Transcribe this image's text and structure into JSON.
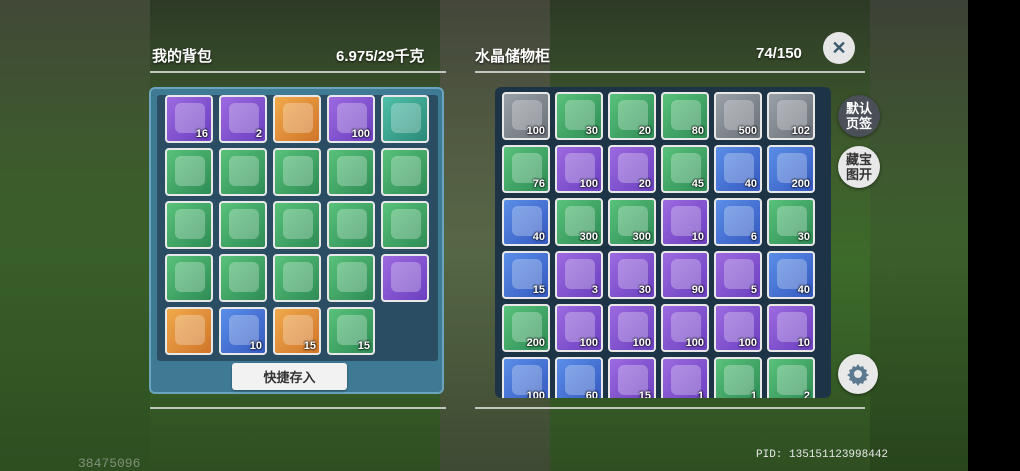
{
  "backpack": {
    "title": "我的背包",
    "weight": "6.975/29千克",
    "quick_store_label": "快捷存入",
    "slots": [
      {
        "icon": "scroll-icon",
        "color": "purple",
        "count": "16"
      },
      {
        "icon": "crystal-creature-icon",
        "color": "purple",
        "count": "2"
      },
      {
        "icon": "horn-icon",
        "color": "orange",
        "count": ""
      },
      {
        "icon": "goggles-creature-icon",
        "color": "purple",
        "count": "100"
      },
      {
        "icon": "cube-icon",
        "color": "teal",
        "count": ""
      },
      {
        "icon": "lantern-icon",
        "color": "green",
        "count": ""
      },
      {
        "icon": "lantern-icon",
        "color": "green",
        "count": ""
      },
      {
        "icon": "lantern-icon",
        "color": "green",
        "count": ""
      },
      {
        "icon": "lantern-icon",
        "color": "green",
        "count": ""
      },
      {
        "icon": "lantern-icon",
        "color": "green",
        "count": ""
      },
      {
        "icon": "lantern-icon",
        "color": "green",
        "count": ""
      },
      {
        "icon": "lantern-icon",
        "color": "green",
        "count": ""
      },
      {
        "icon": "lantern-icon",
        "color": "green",
        "count": ""
      },
      {
        "icon": "lantern-icon",
        "color": "green",
        "count": ""
      },
      {
        "icon": "lantern-icon",
        "color": "green",
        "count": ""
      },
      {
        "icon": "lantern-icon",
        "color": "green",
        "count": ""
      },
      {
        "icon": "blue-lizard-icon",
        "color": "green",
        "count": ""
      },
      {
        "icon": "blue-lizard-icon",
        "color": "green",
        "count": ""
      },
      {
        "icon": "fish-fillet-icon",
        "color": "green",
        "count": ""
      },
      {
        "icon": "bow-icon",
        "color": "purple",
        "count": ""
      },
      {
        "icon": "crystal-cat-icon",
        "color": "orange",
        "count": ""
      },
      {
        "icon": "salmon-dish-icon",
        "color": "blue",
        "count": "10"
      },
      {
        "icon": "pet-food-bag-icon",
        "color": "orange",
        "count": "15"
      },
      {
        "icon": "soup-bowl-icon",
        "color": "green",
        "count": "15"
      }
    ]
  },
  "storage": {
    "title": "水晶储物柜",
    "capacity": "74/150",
    "slots": [
      {
        "icon": "flower-pot-icon",
        "color": "gray",
        "count": "100"
      },
      {
        "icon": "blue-berries-icon",
        "color": "green",
        "count": "30"
      },
      {
        "icon": "bones-icon",
        "color": "green",
        "count": "20"
      },
      {
        "icon": "leaves-icon",
        "color": "green",
        "count": "80"
      },
      {
        "icon": "raw-meat-icon",
        "color": "gray",
        "count": "500"
      },
      {
        "icon": "raw-meat-icon",
        "color": "gray",
        "count": "102"
      },
      {
        "icon": "bacon-icon",
        "color": "green",
        "count": "76"
      },
      {
        "icon": "bacon-icon",
        "color": "purple",
        "count": "100"
      },
      {
        "icon": "bacon-icon",
        "color": "purple",
        "count": "20"
      },
      {
        "icon": "bird-icon",
        "color": "green",
        "count": "45"
      },
      {
        "icon": "purple-berries-bowl-icon",
        "color": "blue",
        "count": "40"
      },
      {
        "icon": "insect-icon",
        "color": "blue",
        "count": "200"
      },
      {
        "icon": "insect-icon",
        "color": "blue",
        "count": "40"
      },
      {
        "icon": "shrimp-icon",
        "color": "green",
        "count": "300"
      },
      {
        "icon": "shrimp-icon",
        "color": "green",
        "count": "300"
      },
      {
        "icon": "orange-fish-icon",
        "color": "purple",
        "count": "10"
      },
      {
        "icon": "green-fish-icon",
        "color": "blue",
        "count": "6"
      },
      {
        "icon": "firefly-icon",
        "color": "green",
        "count": "30"
      },
      {
        "icon": "pink-flower-icon",
        "color": "blue",
        "count": "15"
      },
      {
        "icon": "feather-icon",
        "color": "purple",
        "count": "3"
      },
      {
        "icon": "food-bag-icon",
        "color": "purple",
        "count": "30"
      },
      {
        "icon": "food-bag-icon",
        "color": "purple",
        "count": "90"
      },
      {
        "icon": "food-bag-icon",
        "color": "purple",
        "count": "5"
      },
      {
        "icon": "fish-dish-icon",
        "color": "blue",
        "count": "40"
      },
      {
        "icon": "fish-dish-icon",
        "color": "green",
        "count": "200"
      },
      {
        "icon": "golden-egg-icon",
        "color": "purple",
        "count": "100"
      },
      {
        "icon": "golden-egg-icon",
        "color": "purple",
        "count": "100"
      },
      {
        "icon": "golden-egg-icon",
        "color": "purple",
        "count": "100"
      },
      {
        "icon": "golden-egg-icon",
        "color": "purple",
        "count": "100"
      },
      {
        "icon": "milk-carton-icon",
        "color": "purple",
        "count": "10"
      },
      {
        "icon": "white-flower-icon",
        "color": "blue",
        "count": "100"
      },
      {
        "icon": "pink-flower-icon",
        "color": "blue",
        "count": "60"
      },
      {
        "icon": "sack-icon",
        "color": "purple",
        "count": "15"
      },
      {
        "icon": "sack-icon",
        "color": "purple",
        "count": "1"
      },
      {
        "icon": "seed-bag-icon",
        "color": "green",
        "count": "1"
      },
      {
        "icon": "seed-bag-icon",
        "color": "green",
        "count": "2"
      }
    ]
  },
  "buttons": {
    "close_label": "✕",
    "default_page_label": "默认页签",
    "treasure_map_label": "藏宝图开",
    "settings_icon": "gear-icon"
  },
  "footer": {
    "pid": "PID: 135151123998442",
    "uid": "38475096"
  },
  "colors": {
    "panel_left": "#3b6f8a",
    "panel_right": "#1f3a50",
    "slot_border": "#e8e8e8"
  }
}
